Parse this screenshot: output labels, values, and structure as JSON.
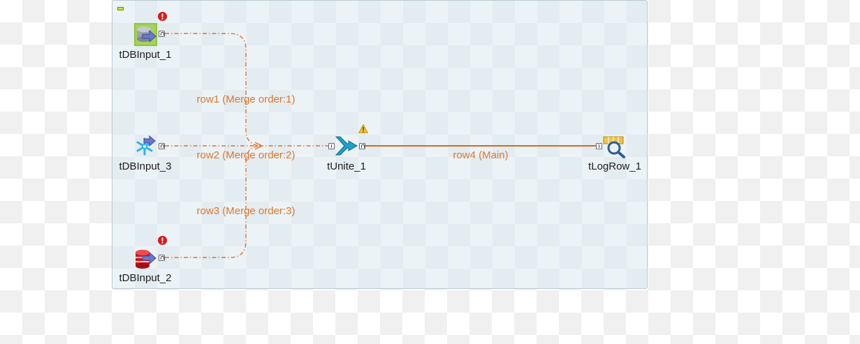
{
  "canvas": {
    "colors": {
      "link_orange": "#e0752c",
      "canvas_bg": "#ecf3f7",
      "error_red": "#e2141c",
      "warning_yellow": "#f3c12a"
    }
  },
  "components": [
    {
      "id": "tDBInput_1",
      "label": "tDBInput_1",
      "icon": "database-input-icon",
      "status": "error"
    },
    {
      "id": "tDBInput_3",
      "label": "tDBInput_3",
      "icon": "snowflake-input-icon",
      "status": "none"
    },
    {
      "id": "tDBInput_2",
      "label": "tDBInput_2",
      "icon": "red-database-input-icon",
      "status": "error"
    },
    {
      "id": "tUnite_1",
      "label": "tUnite_1",
      "icon": "unite-merge-icon",
      "status": "warning"
    },
    {
      "id": "tLogRow_1",
      "label": "tLogRow_1",
      "icon": "log-row-icon",
      "status": "none"
    }
  ],
  "links": [
    {
      "label": "row1 (Merge order:1)",
      "from": "tDBInput_1",
      "to": "tUnite_1"
    },
    {
      "label": "row2 (Merge order:2)",
      "from": "tDBInput_3",
      "to": "tUnite_1"
    },
    {
      "label": "row3 (Merge order:3)",
      "from": "tDBInput_2",
      "to": "tUnite_1"
    },
    {
      "label": "row4 (Main)",
      "from": "tUnite_1",
      "to": "tLogRow_1"
    }
  ]
}
